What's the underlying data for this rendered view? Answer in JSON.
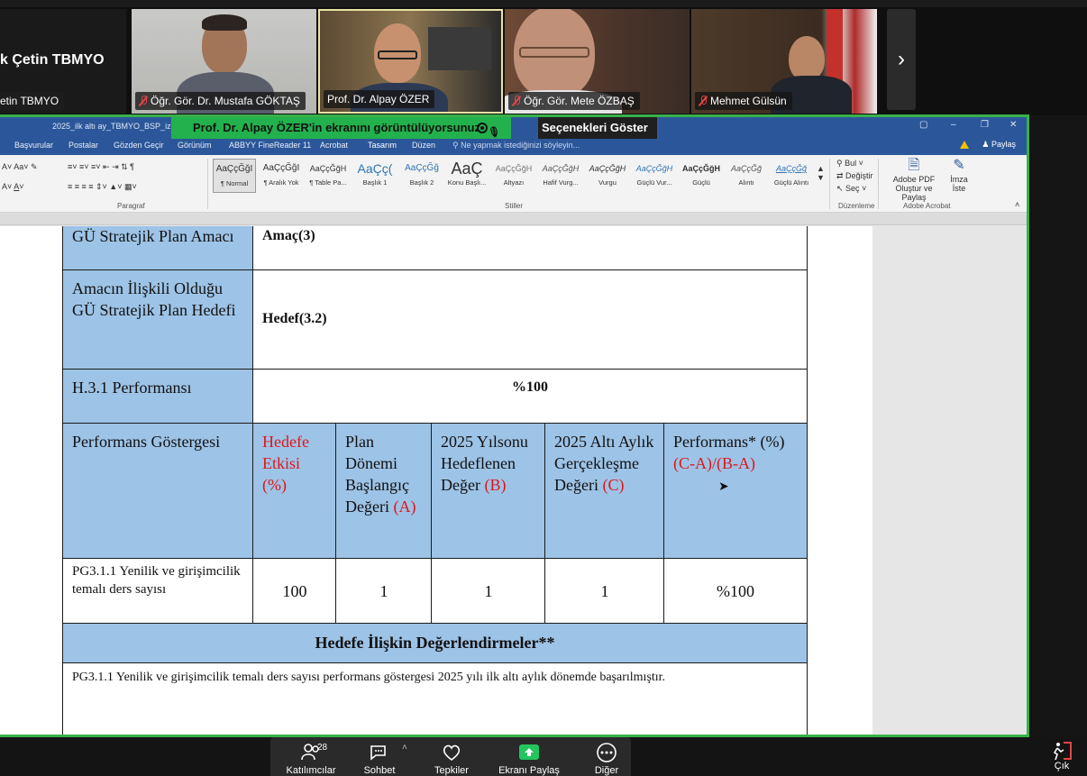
{
  "participants": {
    "self": {
      "name": "k Çetin TBMYO",
      "tag": "etin TBMYO"
    },
    "tiles": [
      {
        "name": "Öğr. Gör. Dr. Mustafa GÖKTAŞ",
        "muted": true
      },
      {
        "name": "Prof. Dr. Alpay ÖZER",
        "muted": false,
        "active_speaker": true
      },
      {
        "name": "Öğr. Gör. Mete ÖZBAŞ",
        "muted": true
      },
      {
        "name": "Mehmet Gülsün",
        "muted": true
      }
    ],
    "next_icon": "chevron-right-icon"
  },
  "share_banner": {
    "text": "Prof. Dr. Alpay ÖZER'in ekranını görüntülüyorsunuz",
    "options_label": "Seçenekleri Göster"
  },
  "word": {
    "doc_title": "2025_ilk altı ay_TBMYO_BSP_izleme",
    "tabs": [
      "Başvurular",
      "Postalar",
      "Gözden Geçir",
      "Görünüm",
      "ABBYY FineReader 11",
      "Acrobat",
      "Tasarım",
      "Düzen"
    ],
    "search_tip": "Ne yapmak istediğinizi söyleyin...",
    "share_label": "Paylaş",
    "styles": [
      {
        "sample": "AaÇçĞğI",
        "label": "¶ Normal"
      },
      {
        "sample": "AaÇçĞğI",
        "label": "¶ Aralık Yok"
      },
      {
        "sample": "AaÇçĞğH",
        "label": "¶ Table Pa..."
      },
      {
        "sample": "AaÇç(",
        "label": "Başlık 1"
      },
      {
        "sample": "AaÇçĞğ",
        "label": "Başlık 2"
      },
      {
        "sample": "AaÇ",
        "label": "Konu Başlı..."
      },
      {
        "sample": "AaÇçĞğH",
        "label": "Altyazı"
      },
      {
        "sample": "AaÇçĞğH",
        "label": "Hafif Vurg..."
      },
      {
        "sample": "AaÇçĞğH",
        "label": "Vurgu"
      },
      {
        "sample": "AaÇçĞğH",
        "label": "Güçlü Vur..."
      },
      {
        "sample": "AaÇçĞğH",
        "label": "Güçlü"
      },
      {
        "sample": "AaÇçĞğ",
        "label": "Alıntı"
      },
      {
        "sample": "AaÇçĞğ",
        "label": "Güçlü Alıntı"
      }
    ],
    "group_labels": {
      "paragraph": "Paragraf",
      "styles": "Stiller",
      "editing": "Düzenleme",
      "acrobat": "Adobe Acrobat"
    },
    "editing": {
      "find": "Bul",
      "replace": "Değiştir",
      "select": "Seç"
    },
    "acrobat": {
      "pdf": "Adobe PDF Oluştur ve Paylaş",
      "sign": "İmza İste"
    }
  },
  "table": {
    "row1": {
      "label": "GÜ Stratejik Plan Amacı",
      "value": "Amaç(3)"
    },
    "row2": {
      "label": "Amacın İlişkili Olduğu GÜ Stratejik Plan Hedefi",
      "value": "Hedef(3.2)"
    },
    "row3": {
      "label": "H.3.1 Performansı",
      "value": "%100"
    },
    "headers": {
      "indicator": "Performans Göstergesi",
      "effect": "Hedefe Etkisi (%)",
      "baseline": "Plan Dönemi Başlangıç Değeri",
      "baseline_code": "(A)",
      "target": "2025 Yılsonu Hedeflenen Değer",
      "target_code": "(B)",
      "actual": "2025 Altı Aylık Gerçekleşme Değeri",
      "actual_code": "(C)",
      "performance": "Performans* (%)",
      "performance_formula": "(C-A)/(B-A)"
    },
    "data_row": {
      "indicator": "PG3.1.1 Yenilik ve girişimcilik temalı ders sayısı",
      "effect": "100",
      "baseline": "1",
      "target": "1",
      "actual": "1",
      "performance": "%100"
    },
    "evaluation_header": "Hedefe İlişkin Değerlendirmeler**",
    "evaluation_text": "PG3.1.1 Yenilik ve girişimcilik temalı ders sayısı performans göstergesi 2025 yılı ilk altı aylık dönemde başarılmıştır."
  },
  "toolbar": {
    "participants_label": "Katılımcılar",
    "participants_count": "28",
    "chat_label": "Sohbet",
    "reactions_label": "Tepkiler",
    "share_label": "Ekranı Paylaş",
    "more_label": "Diğer",
    "exit_label": "Çık"
  },
  "colors": {
    "share_border": "#38b04a",
    "word_blue": "#2b579a",
    "header_fill": "#9dc3e6",
    "red_text": "#e0161b"
  }
}
